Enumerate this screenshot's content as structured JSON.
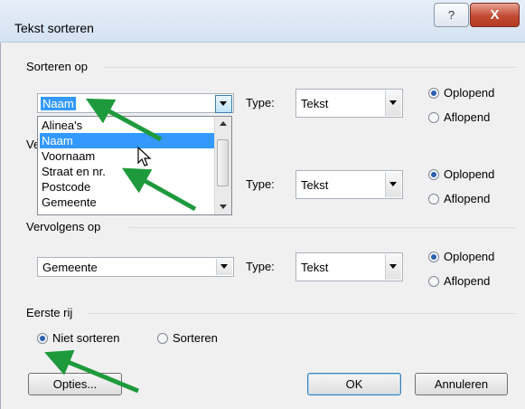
{
  "window": {
    "title": "Tekst sorteren",
    "help_label": "?",
    "close_label": "X"
  },
  "sort1": {
    "group_label": "Sorteren op",
    "field_value": "Naam",
    "type_label": "Type:",
    "type_value": "Tekst",
    "asc_label": "Oplopend",
    "desc_label": "Aflopend",
    "asc_checked": true
  },
  "dropdown": {
    "items": [
      "Alinea's",
      "Naam",
      "Voornaam",
      "Straat en nr.",
      "Postcode",
      "Gemeente"
    ],
    "selected_index": 1
  },
  "sort2": {
    "group_label": "Vervolgens op",
    "type_label": "Type:",
    "type_value": "Tekst",
    "asc_label": "Oplopend",
    "desc_label": "Aflopend",
    "asc_checked": true
  },
  "sort3": {
    "group_label": "Vervolgens op",
    "field_value": "Gemeente",
    "type_label": "Type:",
    "type_value": "Tekst",
    "asc_label": "Oplopend",
    "desc_label": "Aflopend",
    "asc_checked": true
  },
  "first_row": {
    "group_label": "Eerste rij",
    "no_sort_label": "Niet sorteren",
    "sort_label": "Sorteren",
    "no_sort_checked": true
  },
  "buttons": {
    "options": "Opties...",
    "ok": "OK",
    "cancel": "Annuleren"
  },
  "colors": {
    "annotation_arrow": "#1e9a3c",
    "selection": "#3399ff"
  }
}
